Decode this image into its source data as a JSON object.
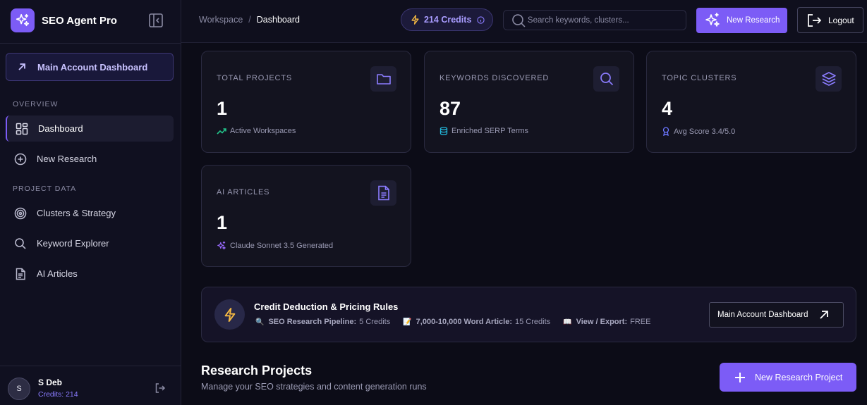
{
  "brand": {
    "name": "SEO Agent Pro"
  },
  "sidebar": {
    "main_account_label": "Main Account Dashboard",
    "overview_label": "OVERVIEW",
    "project_data_label": "PROJECT DATA",
    "items": [
      {
        "label": "Dashboard",
        "icon": "grid-icon",
        "active": true
      },
      {
        "label": "New Research",
        "icon": "plus-circle-icon",
        "active": false
      },
      {
        "label": "Clusters & Strategy",
        "icon": "target-icon",
        "active": false
      },
      {
        "label": "Keyword Explorer",
        "icon": "search-icon",
        "active": false
      },
      {
        "label": "AI Articles",
        "icon": "document-icon",
        "active": false
      }
    ],
    "user": {
      "initial": "S",
      "name": "S Deb",
      "credits": "Credits: 214"
    }
  },
  "header": {
    "breadcrumb": {
      "root": "Workspace",
      "separator": "/",
      "current": "Dashboard"
    },
    "credits": "214 Credits",
    "search_placeholder": "Search keywords, clusters...",
    "new_research_label": "New Research",
    "logout_label": "Logout"
  },
  "stats": [
    {
      "title": "TOTAL PROJECTS",
      "value": "1",
      "sub": "Active Workspaces",
      "icon": "folder-icon",
      "sub_icon": "trend-up-icon"
    },
    {
      "title": "KEYWORDS DISCOVERED",
      "value": "87",
      "sub": "Enriched SERP Terms",
      "icon": "search-icon",
      "sub_icon": "database-icon"
    },
    {
      "title": "TOPIC CLUSTERS",
      "value": "4",
      "sub": "Avg Score 3.4/5.0",
      "icon": "layers-icon",
      "sub_icon": "award-icon"
    },
    {
      "title": "AI ARTICLES",
      "value": "1",
      "sub": "Claude Sonnet 3.5 Generated",
      "icon": "document-icon",
      "sub_icon": "sparkles-icon"
    }
  ],
  "rules": {
    "title": "Credit Deduction & Pricing Rules",
    "items": [
      {
        "emoji": "🔍",
        "label": "SEO Research Pipeline:",
        "value": "5 Credits"
      },
      {
        "emoji": "📝",
        "label": "7,000-10,000 Word Article:",
        "value": "15 Credits"
      },
      {
        "emoji": "📖",
        "label": "View / Export:",
        "value": "FREE"
      }
    ],
    "button_label": "Main Account Dashboard"
  },
  "projects": {
    "title": "Research Projects",
    "subtitle": "Manage your SEO strategies and content generation runs",
    "new_button_label": "New Research Project"
  },
  "colors": {
    "accent": "#7c5cf6",
    "background": "#0c0c17",
    "card": "#13131f",
    "credits_text": "#a99cff"
  }
}
